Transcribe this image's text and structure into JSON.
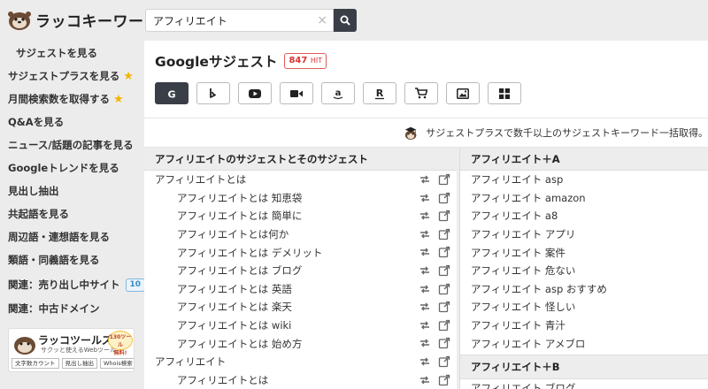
{
  "header": {
    "logo_text": "ラッコキーワード",
    "search": {
      "value": "アフィリエイト",
      "placeholder": ""
    },
    "clear_glyph": "×"
  },
  "sidebar": {
    "items": [
      {
        "label": "サジェストを見る",
        "active": true
      },
      {
        "label": "サジェストプラスを見る",
        "star": true
      },
      {
        "label": "月間検索数を取得する",
        "star": true
      },
      {
        "label": "Q&Aを見る"
      },
      {
        "label": "ニュース/話題の記事を見る"
      },
      {
        "label": "Googleトレンドを見る"
      },
      {
        "label": "見出し抽出"
      },
      {
        "label": "共起語を見る"
      },
      {
        "label": "周辺語・連想語を見る"
      },
      {
        "label": "類語・同義語を見る"
      },
      {
        "label": "関連：売り出し中サイト",
        "badge": "10"
      },
      {
        "label": "関連：中古ドメイン"
      }
    ],
    "banner": {
      "title": "ラッコツールズ",
      "subtitle": "サクッと使えるWebツール",
      "bubble_line1": "130ツール",
      "bubble_line2": "無料!",
      "tags": [
        "文字数カウント",
        "見出し抽出",
        "Whois検索"
      ]
    }
  },
  "main": {
    "title": "Googleサジェスト",
    "hit_count": "847",
    "hit_unit": "HIT",
    "engines": [
      {
        "name": "google",
        "active": true
      },
      {
        "name": "bing"
      },
      {
        "name": "youtube"
      },
      {
        "name": "video"
      },
      {
        "name": "amazon"
      },
      {
        "name": "rakuten"
      },
      {
        "name": "shopping"
      },
      {
        "name": "image"
      },
      {
        "name": "apps"
      }
    ],
    "promo_text": "サジェストプラスで数千以上のサジェストキーワード一括取得。",
    "left_column": {
      "header": "アフィリエイトのサジェストとそのサジェスト",
      "rows": [
        {
          "text": "アフィリエイトとは",
          "level": 0
        },
        {
          "text": "アフィリエイトとは 知恵袋",
          "level": 1
        },
        {
          "text": "アフィリエイトとは 簡単に",
          "level": 1
        },
        {
          "text": "アフィリエイトとは何か",
          "level": 1
        },
        {
          "text": "アフィリエイトとは デメリット",
          "level": 1
        },
        {
          "text": "アフィリエイトとは ブログ",
          "level": 1
        },
        {
          "text": "アフィリエイトとは 英語",
          "level": 1
        },
        {
          "text": "アフィリエイトとは 楽天",
          "level": 1
        },
        {
          "text": "アフィリエイトとは wiki",
          "level": 1
        },
        {
          "text": "アフィリエイトとは 始め方",
          "level": 1
        },
        {
          "text": "アフィリエイト",
          "level": 0
        },
        {
          "text": "アフィリエイトとは",
          "level": 1
        }
      ]
    },
    "right_column": {
      "header_a": "アフィリエイト＋A",
      "rows_a": [
        "アフィリエイト asp",
        "アフィリエイト amazon",
        "アフィリエイト a8",
        "アフィリエイト アプリ",
        "アフィリエイト 案件",
        "アフィリエイト 危ない",
        "アフィリエイト asp おすすめ",
        "アフィリエイト 怪しい",
        "アフィリエイト 青汁",
        "アフィリエイト アメブロ"
      ],
      "header_b": "アフィリエイト＋B",
      "rows_b": [
        "アフィリエイト ブログ"
      ]
    }
  },
  "colors": {
    "accent_dark": "#3a3f47",
    "hit_red": "#d33",
    "star": "#f4b400",
    "badge_blue": "#3a8dc5"
  }
}
